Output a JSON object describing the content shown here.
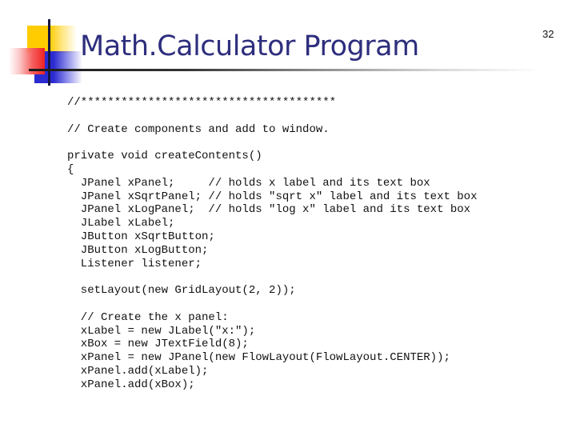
{
  "slide": {
    "title": "Math.Calculator Program",
    "page_number": "32"
  },
  "code": {
    "lines": [
      "//**************************************",
      "",
      "// Create components and add to window.",
      "",
      "private void createContents()",
      "{",
      "  JPanel xPanel;     // holds x label and its text box",
      "  JPanel xSqrtPanel; // holds \"sqrt x\" label and its text box",
      "  JPanel xLogPanel;  // holds \"log x\" label and its text box",
      "  JLabel xLabel;",
      "  JButton xSqrtButton;",
      "  JButton xLogButton;",
      "  Listener listener;",
      "",
      "  setLayout(new GridLayout(2, 2));",
      "",
      "  // Create the x panel:",
      "  xLabel = new JLabel(\"x:\");",
      "  xBox = new JTextField(8);",
      "  xPanel = new JPanel(new FlowLayout(FlowLayout.CENTER));",
      "  xPanel.add(xLabel);",
      "  xPanel.add(xBox);"
    ]
  },
  "colors": {
    "title": "#2e2e7e",
    "logo_yellow": "#ffcc00",
    "logo_red": "#ee2222",
    "logo_blue": "#2b2bd1"
  }
}
